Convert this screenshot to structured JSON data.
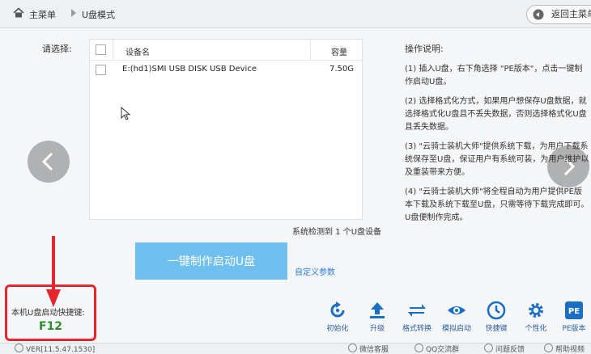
{
  "breadcrumb": {
    "home": "主菜单",
    "current": "U盘模式"
  },
  "header": {
    "back_label": "返回主菜单"
  },
  "select_label": "请选择:",
  "table": {
    "headers": {
      "device": "设备名",
      "capacity": "容量"
    },
    "rows": [
      {
        "device": "E:(hd1)SMI USB DISK USB Device",
        "capacity": "7.50G"
      }
    ]
  },
  "detect_text": "系统检测到 1 个U盘设备",
  "make_button": "一键制作启动U盘",
  "custom_link": "自定义参数",
  "instructions": {
    "title": "操作说明:",
    "steps": [
      "(1) 插入U盘，右下角选择 \"PE版本\"，点击一键制作启动U盘。",
      "(2) 选择格式化方式，如果用户想保存U盘数据，就选择格式化U盘且不丢失数据，否则选择格式化U盘且丢失数据。",
      "(3) \"云骑士装机大师\"提供系统下载，为用户下载系统保存至U盘，保证用户有系统可装，为用户维护以及重装带来方便。",
      "(4) \"云骑士装机大师\"将全程自动为用户提供PE版本下载及系统下载至U盘，只需等待下载完成即可。U盘便制作完成。"
    ]
  },
  "hotkey": {
    "label": "本机U盘启动快捷键:",
    "key": "F12"
  },
  "toolbar": {
    "items": [
      {
        "label": "初始化",
        "icon": "refresh-icon"
      },
      {
        "label": "升级",
        "icon": "upload-icon"
      },
      {
        "label": "格式转换",
        "icon": "convert-icon"
      },
      {
        "label": "模拟启动",
        "icon": "eye-icon"
      },
      {
        "label": "快捷键",
        "icon": "keyboard-icon"
      },
      {
        "label": "个性化",
        "icon": "gear-icon"
      },
      {
        "label": "PE版本",
        "icon": "pe-icon"
      }
    ]
  },
  "statusbar": {
    "version": "VER[11.5.47.1530]",
    "wechat": "微信客服",
    "qq": "QQ交流群",
    "feedback": "问题反馈",
    "help": "帮助视频"
  },
  "colors": {
    "accent": "#6fc0ee",
    "link": "#2b7bd6",
    "highlight": "#e6262e",
    "toolbar_icon": "#1a6fc4"
  }
}
